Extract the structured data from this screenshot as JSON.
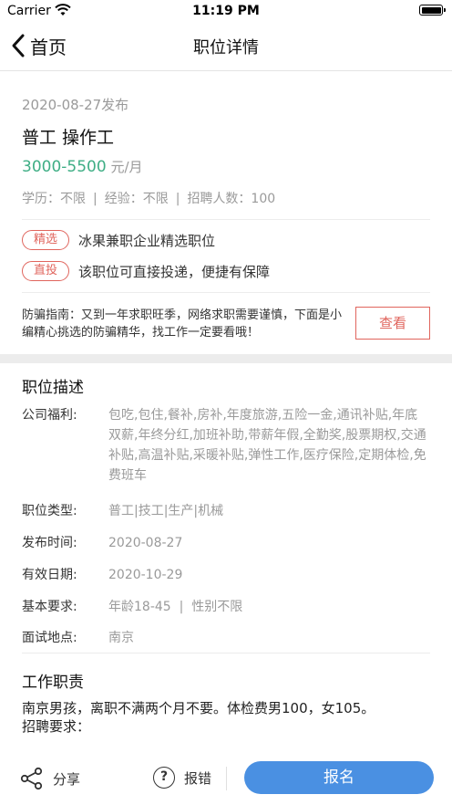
{
  "status_bar": {
    "carrier": "Carrier",
    "time": "11:19 PM"
  },
  "nav": {
    "back_label": "首页",
    "title": "职位详情"
  },
  "job": {
    "publish_date": "2020-08-27发布",
    "title": "普工 操作工",
    "salary": "3000-5500",
    "salary_unit": " 元/月",
    "education": "学历：不限",
    "experience": "经验：不限",
    "headcount": "招聘人数：100"
  },
  "tags": [
    {
      "label": "精选",
      "text": "冰果兼职企业精选职位"
    },
    {
      "label": "直投",
      "text": "该职位可直接投递，便捷有保障"
    }
  ],
  "guide": {
    "text": "防骗指南：又到一年求职旺季，网络求职需要谨慎，下面是小编精心挑选的防骗精华，找工作一定要看哦！",
    "button": "查看"
  },
  "description": {
    "heading": "职位描述",
    "welfare_label": "公司福利:",
    "welfare_value": "包吃,包住,餐补,房补,年度旅游,五险一金,通讯补贴,年底双薪,年终分红,加班补助,带薪年假,全勤奖,股票期权,交通补贴,高温补贴,采暖补贴,弹性工作,医疗保险,定期体检,免费班车",
    "type_label": "职位类型:",
    "type_value": "普工|技工|生产|机械",
    "publish_label": "发布时间:",
    "publish_value": "2020-08-27",
    "valid_label": "有效日期:",
    "valid_value": "2020-10-29",
    "requirement_label": "基本要求:",
    "requirement_value": "年龄18-45  |  性别不限",
    "location_label": "面试地点:",
    "location_value": "南京"
  },
  "duties": {
    "heading": "工作职责",
    "text": "南京男孩，离职不满两个月不要。体检费男100，女105。\n招聘要求："
  },
  "bottom_bar": {
    "share_label": "分享",
    "report_label": "报错",
    "report_icon": "?",
    "apply_label": "报名"
  },
  "colors": {
    "accent": "#4a90e2",
    "salary": "#3fae85",
    "tag": "#e0655d"
  }
}
